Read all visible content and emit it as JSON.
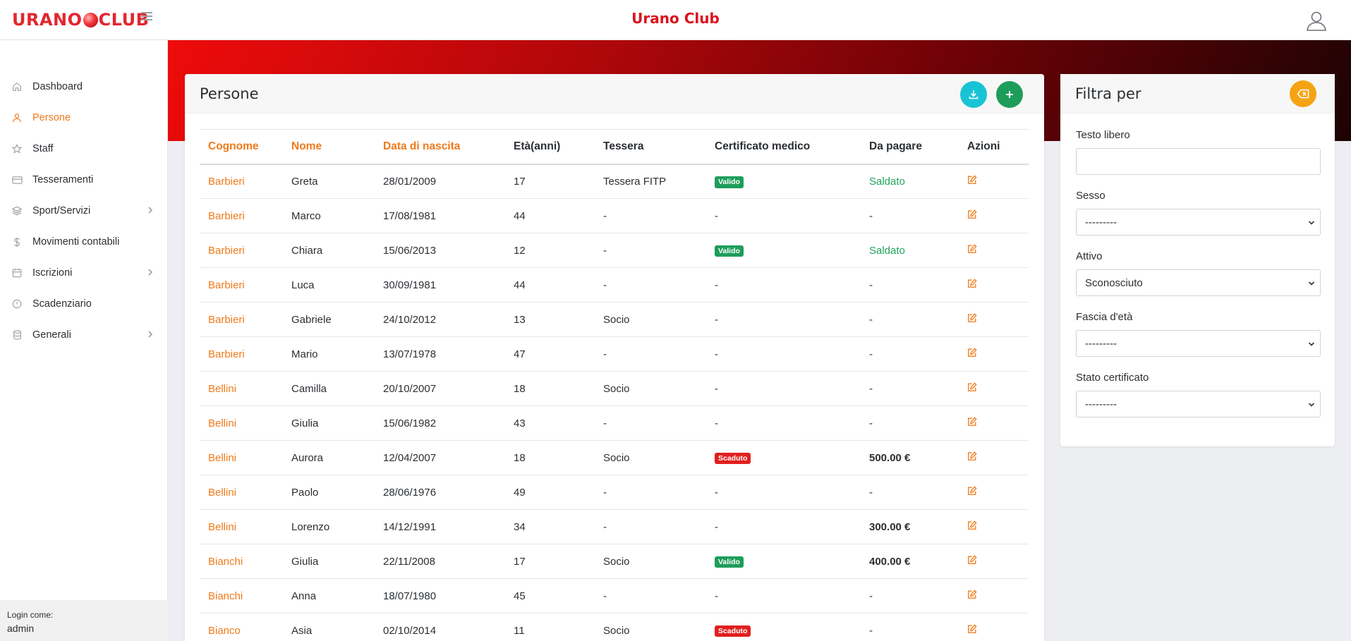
{
  "navbar": {
    "logo_left": "URANO",
    "logo_right": "CLUB",
    "title": "Urano Club"
  },
  "sidebar": {
    "items": [
      {
        "label": "Dashboard",
        "icon": "home-icon"
      },
      {
        "label": "Persone",
        "icon": "user-icon",
        "active": true
      },
      {
        "label": "Staff",
        "icon": "star-icon"
      },
      {
        "label": "Tesseramenti",
        "icon": "card-icon"
      },
      {
        "label": "Sport/Servizi",
        "icon": "layers-icon",
        "expandable": true
      },
      {
        "label": "Movimenti contabili",
        "icon": "dollar-icon"
      },
      {
        "label": "Iscrizioni",
        "icon": "calendar-icon",
        "expandable": true
      },
      {
        "label": "Scadenziario",
        "icon": "alert-circle-icon"
      },
      {
        "label": "Generali",
        "icon": "database-icon",
        "expandable": true
      }
    ],
    "login_label": "Login come:",
    "login_user": "admin"
  },
  "main": {
    "title": "Persone",
    "columns": [
      "Cognome",
      "Nome",
      "Data di nascita",
      "Età(anni)",
      "Tessera",
      "Certificato medico",
      "Da pagare",
      "Azioni"
    ],
    "rows": [
      {
        "cognome": "Barbieri",
        "nome": "Greta",
        "nascita": "28/01/2009",
        "eta": "17",
        "tessera": "Tessera FITP",
        "certificato": "Valido",
        "da_pagare": "Saldato"
      },
      {
        "cognome": "Barbieri",
        "nome": "Marco",
        "nascita": "17/08/1981",
        "eta": "44",
        "tessera": "-",
        "certificato": "-",
        "da_pagare": "-"
      },
      {
        "cognome": "Barbieri",
        "nome": "Chiara",
        "nascita": "15/06/2013",
        "eta": "12",
        "tessera": "-",
        "certificato": "Valido",
        "da_pagare": "Saldato"
      },
      {
        "cognome": "Barbieri",
        "nome": "Luca",
        "nascita": "30/09/1981",
        "eta": "44",
        "tessera": "-",
        "certificato": "-",
        "da_pagare": "-"
      },
      {
        "cognome": "Barbieri",
        "nome": "Gabriele",
        "nascita": "24/10/2012",
        "eta": "13",
        "tessera": "Socio",
        "certificato": "-",
        "da_pagare": "-"
      },
      {
        "cognome": "Barbieri",
        "nome": "Mario",
        "nascita": "13/07/1978",
        "eta": "47",
        "tessera": "-",
        "certificato": "-",
        "da_pagare": "-"
      },
      {
        "cognome": "Bellini",
        "nome": "Camilla",
        "nascita": "20/10/2007",
        "eta": "18",
        "tessera": "Socio",
        "certificato": "-",
        "da_pagare": "-"
      },
      {
        "cognome": "Bellini",
        "nome": "Giulia",
        "nascita": "15/06/1982",
        "eta": "43",
        "tessera": "-",
        "certificato": "-",
        "da_pagare": "-"
      },
      {
        "cognome": "Bellini",
        "nome": "Aurora",
        "nascita": "12/04/2007",
        "eta": "18",
        "tessera": "Socio",
        "certificato": "Scaduto",
        "da_pagare": "500.00 €"
      },
      {
        "cognome": "Bellini",
        "nome": "Paolo",
        "nascita": "28/06/1976",
        "eta": "49",
        "tessera": "-",
        "certificato": "-",
        "da_pagare": "-"
      },
      {
        "cognome": "Bellini",
        "nome": "Lorenzo",
        "nascita": "14/12/1991",
        "eta": "34",
        "tessera": "-",
        "certificato": "-",
        "da_pagare": "300.00 €"
      },
      {
        "cognome": "Bianchi",
        "nome": "Giulia",
        "nascita": "22/11/2008",
        "eta": "17",
        "tessera": "Socio",
        "certificato": "Valido",
        "da_pagare": "400.00 €"
      },
      {
        "cognome": "Bianchi",
        "nome": "Anna",
        "nascita": "18/07/1980",
        "eta": "45",
        "tessera": "-",
        "certificato": "-",
        "da_pagare": "-"
      },
      {
        "cognome": "Bianco",
        "nome": "Asia",
        "nascita": "02/10/2014",
        "eta": "11",
        "tessera": "Socio",
        "certificato": "Scaduto",
        "da_pagare": "-"
      }
    ]
  },
  "filter": {
    "title": "Filtra per",
    "free_text_label": "Testo libero",
    "free_text_value": "",
    "sex_label": "Sesso",
    "sex_value": "---------",
    "active_label": "Attivo",
    "active_value": "Sconosciuto",
    "age_label": "Fascia d'età",
    "age_value": "---------",
    "cert_label": "Stato certificato",
    "cert_value": "---------"
  },
  "colors": {
    "accent": "#f07a1a",
    "brand_red": "#d9141f",
    "valid_green": "#1e9d5a",
    "expired_red": "#e0201f",
    "download_cyan": "#19c3d6",
    "clear_orange": "#f5a312"
  }
}
